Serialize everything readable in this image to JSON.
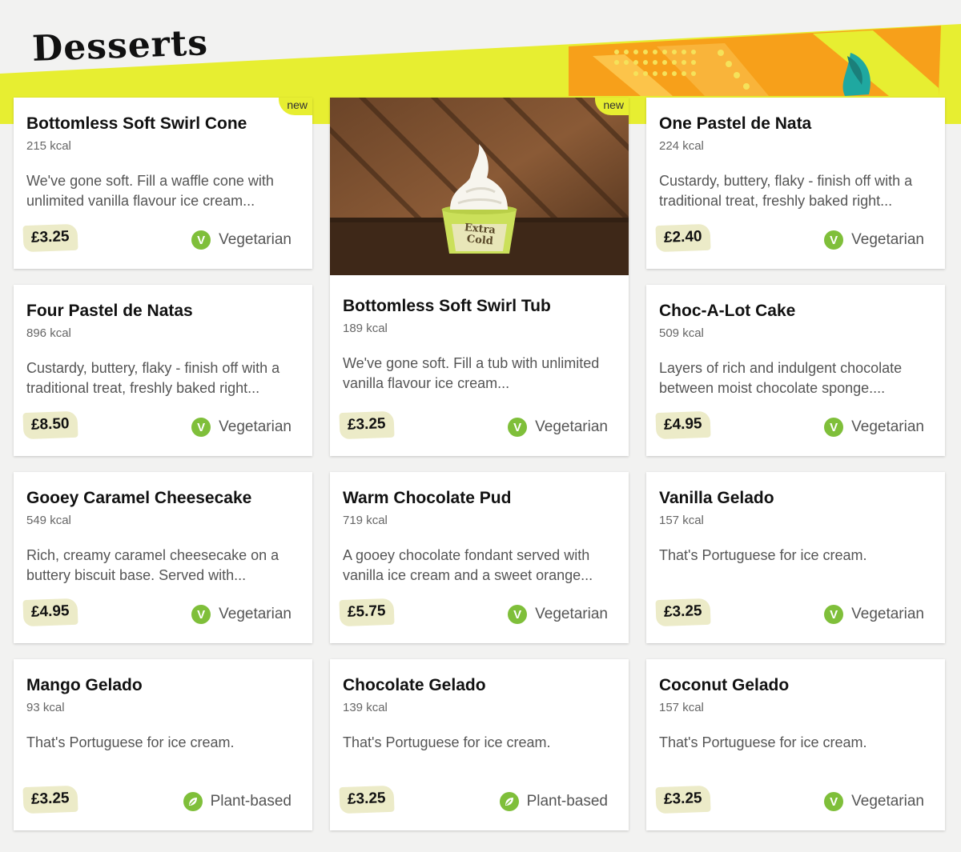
{
  "page": {
    "title": "Desserts"
  },
  "colors": {
    "banner_yellow": "#e7ee31",
    "banner_orange": "#f7a01a",
    "veg_green": "#7fbf3a",
    "price_bg": "#ecebc8"
  },
  "items": [
    {
      "name": "Bottomless Soft Swirl Cone",
      "kcal": "215 kcal",
      "desc": "We've gone soft. Fill a waffle cone with unlimited vanilla flavour ice cream...",
      "price": "£3.25",
      "diet": "Vegetarian",
      "diet_icon": "V",
      "badge": "new"
    },
    {
      "name": "Bottomless Soft Swirl Tub",
      "kcal": "189 kcal",
      "desc": "We've gone soft. Fill a tub with unlimited vanilla flavour ice cream...",
      "price": "£3.25",
      "diet": "Vegetarian",
      "diet_icon": "V",
      "badge": "new",
      "image_text": "Extra Cold"
    },
    {
      "name": "One Pastel de Nata",
      "kcal": "224 kcal",
      "desc": "Custardy, buttery, flaky - finish off with a traditional treat, freshly baked right...",
      "price": "£2.40",
      "diet": "Vegetarian",
      "diet_icon": "V"
    },
    {
      "name": "Four Pastel de Natas",
      "kcal": "896 kcal",
      "desc": "Custardy, buttery, flaky - finish off with a traditional treat, freshly baked right...",
      "price": "£8.50",
      "diet": "Vegetarian",
      "diet_icon": "V"
    },
    {
      "name": "Choc-A-Lot Cake",
      "kcal": "509 kcal",
      "desc": "Layers of rich and indulgent chocolate between moist chocolate sponge....",
      "price": "£4.95",
      "diet": "Vegetarian",
      "diet_icon": "V"
    },
    {
      "name": "Gooey Caramel Cheesecake",
      "kcal": "549 kcal",
      "desc": "Rich, creamy caramel cheesecake on a buttery biscuit base. Served with...",
      "price": "£4.95",
      "diet": "Vegetarian",
      "diet_icon": "V"
    },
    {
      "name": "Warm Chocolate Pud",
      "kcal": "719 kcal",
      "desc": "A gooey chocolate fondant served with vanilla ice cream and a sweet orange...",
      "price": "£5.75",
      "diet": "Vegetarian",
      "diet_icon": "V"
    },
    {
      "name": "Vanilla Gelado",
      "kcal": "157 kcal",
      "desc": "That's Portuguese for ice cream.",
      "price": "£3.25",
      "diet": "Vegetarian",
      "diet_icon": "V"
    },
    {
      "name": "Mango Gelado",
      "kcal": "93 kcal",
      "desc": "That's Portuguese for ice cream.",
      "price": "£3.25",
      "diet": "Plant-based",
      "diet_icon": "leaf-icon"
    },
    {
      "name": "Chocolate Gelado",
      "kcal": "139 kcal",
      "desc": "That's Portuguese for ice cream.",
      "price": "£3.25",
      "diet": "Plant-based",
      "diet_icon": "leaf-icon"
    },
    {
      "name": "Coconut Gelado",
      "kcal": "157 kcal",
      "desc": "That's Portuguese for ice cream.",
      "price": "£3.25",
      "diet": "Vegetarian",
      "diet_icon": "V"
    }
  ]
}
